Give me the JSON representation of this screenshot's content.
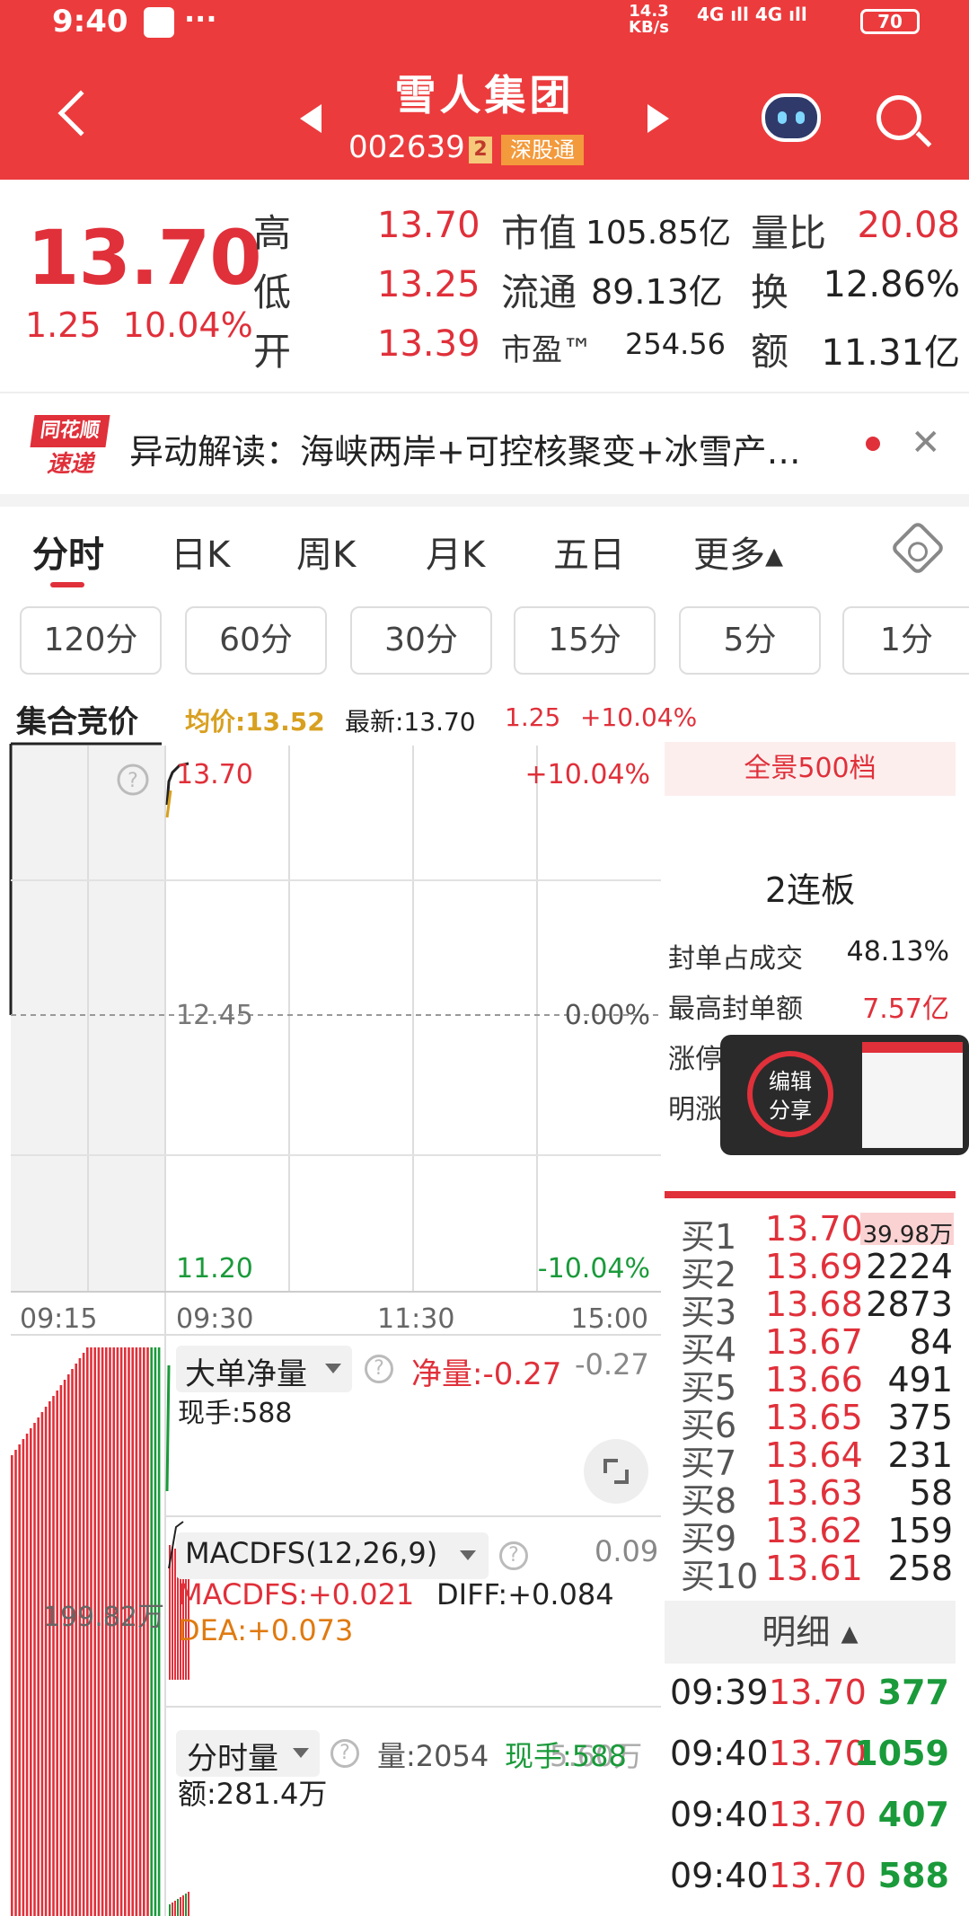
{
  "status_bar": {
    "time": "9:40",
    "more": "···",
    "speed": "14.3\nKB/s",
    "network": "4G ıll 4G ıll",
    "battery": "70"
  },
  "header": {
    "title": "雪人集团",
    "code": "002639",
    "code_badge": "2",
    "connect_badge": "深股通"
  },
  "quote": {
    "price": "13.70",
    "change": "1.25",
    "change_pct": "10.04%",
    "high_label": "高",
    "high": "13.70",
    "low_label": "低",
    "low": "13.25",
    "open_label": "开",
    "open": "13.39",
    "mcap_label": "市值",
    "mcap": "105.85亿",
    "float_label": "流通",
    "float": "89.13亿",
    "pe_label": "市盈™",
    "pe": "254.56",
    "vr_label": "量比",
    "vr": "20.08",
    "turn_label": "换",
    "turn": "12.86%",
    "amt_label": "额",
    "amt": "11.31亿"
  },
  "news": {
    "logo_top": "同花顺",
    "logo_bottom": "速递",
    "text": "异动解读：海峡两岸+可控核聚变+冰雪产…"
  },
  "tabs": [
    {
      "label": "分时"
    },
    {
      "label": "日K"
    },
    {
      "label": "周K"
    },
    {
      "label": "月K"
    },
    {
      "label": "五日"
    },
    {
      "label": "更多▴"
    }
  ],
  "periods": [
    {
      "label": "120分"
    },
    {
      "label": "60分"
    },
    {
      "label": "30分"
    },
    {
      "label": "15分"
    },
    {
      "label": "5分"
    },
    {
      "label": "1分"
    }
  ],
  "chart_header": {
    "auction": "集合竞价",
    "avg": "均价:13.52",
    "latest": "最新:13.70",
    "chg": "1.25",
    "pct": "+10.04%"
  },
  "chart": {
    "price_top": "13.70",
    "pct_top": "+10.04%",
    "price_mid": "12.45",
    "pct_mid": "0.00%",
    "price_bottom": "11.20",
    "pct_bottom": "-10.04%",
    "help": "?",
    "time_labels": [
      "09:15",
      "09:30",
      "11:30",
      "15:00"
    ],
    "auction_volume": "199.82万"
  },
  "panel": {
    "head": "全景500档",
    "lianban": "2连板",
    "rows": [
      {
        "label": "封单占成交",
        "value": "48.13%"
      },
      {
        "label": "最高封单额",
        "value": "7.57亿"
      },
      {
        "label": "涨停成交额",
        "value": ""
      },
      {
        "label": "明涨停",
        "value": ""
      }
    ],
    "share": {
      "line1": "编辑",
      "line2": "分享"
    }
  },
  "order_book": [
    {
      "label": "买1",
      "price": "13.70",
      "vol": "39.98万"
    },
    {
      "label": "买2",
      "price": "13.69",
      "vol": "2224"
    },
    {
      "label": "买3",
      "price": "13.68",
      "vol": "2873"
    },
    {
      "label": "买4",
      "price": "13.67",
      "vol": "84"
    },
    {
      "label": "买5",
      "price": "13.66",
      "vol": "491"
    },
    {
      "label": "买6",
      "price": "13.65",
      "vol": "375"
    },
    {
      "label": "买7",
      "price": "13.64",
      "vol": "231"
    },
    {
      "label": "买8",
      "price": "13.63",
      "vol": "58"
    },
    {
      "label": "买9",
      "price": "13.62",
      "vol": "159"
    },
    {
      "label": "买10",
      "price": "13.61",
      "vol": "258"
    }
  ],
  "detail": {
    "head": "明细 ▴",
    "rows": [
      {
        "time": "09:39",
        "price": "13.70",
        "vol": "377"
      },
      {
        "time": "09:40",
        "price": "13.70",
        "vol": "1059"
      },
      {
        "time": "09:40",
        "price": "13.70",
        "vol": "407"
      },
      {
        "time": "09:40",
        "price": "13.70",
        "vol": "588"
      }
    ]
  },
  "indicators": {
    "big_order": {
      "title": "大单净量",
      "net": "净量:-0.27",
      "right": "-0.27",
      "hand": "现手:588"
    },
    "macd": {
      "title": "MACDFS(12,26,9)",
      "right": "0.09",
      "macdfs": "MACDFS:+0.021",
      "diff": "DIFF:+0.084",
      "dea": "DEA:+0.073"
    },
    "volume": {
      "title": "分时量",
      "vol": "量:2054",
      "hand": "现手:588",
      "right": "5.60万",
      "amount": "额:281.4万"
    }
  },
  "colors": {
    "brand": "#ec3b3d",
    "up": "#e0303a",
    "down": "#1a9a3a",
    "avg": "#d8a020"
  }
}
